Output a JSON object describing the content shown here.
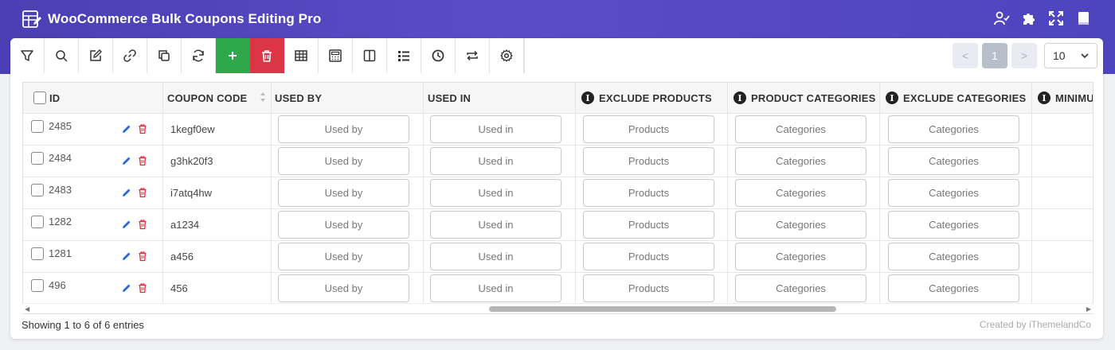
{
  "app": {
    "title": "WooCommerce Bulk Coupons Editing Pro"
  },
  "header_icons": [
    "user-check-icon",
    "puzzle-icon",
    "expand-icon",
    "book-icon"
  ],
  "toolbar": {
    "buttons": [
      {
        "name": "filter-button",
        "icon": "filter-icon"
      },
      {
        "name": "search-button",
        "icon": "search-icon"
      },
      {
        "name": "bulk-edit-button",
        "icon": "edit-icon"
      },
      {
        "name": "bind-edit-button",
        "icon": "link-icon"
      },
      {
        "name": "duplicate-button",
        "icon": "duplicate-icon"
      },
      {
        "name": "reload-button",
        "icon": "refresh-icon"
      },
      {
        "name": "add-coupon-button",
        "icon": "plus-icon"
      },
      {
        "name": "delete-button",
        "icon": "trash-icon"
      },
      {
        "name": "column-profiles-button",
        "icon": "table-icon"
      },
      {
        "name": "calculator-button",
        "icon": "calculator-icon"
      },
      {
        "name": "column-manager-button",
        "icon": "columns-icon"
      },
      {
        "name": "meta-fields-button",
        "icon": "list-icon"
      },
      {
        "name": "history-button",
        "icon": "clock-icon"
      },
      {
        "name": "import-export-button",
        "icon": "swap-icon"
      },
      {
        "name": "settings-button",
        "icon": "gear-icon"
      }
    ]
  },
  "pagination": {
    "prev": "<",
    "current": "1",
    "next": ">",
    "per_page": "10"
  },
  "table": {
    "columns": {
      "id": "ID",
      "coupon_code": "COUPON CODE",
      "used_by": "USED BY",
      "used_in": "USED IN",
      "exclude_products": "EXCLUDE PRODUCTS",
      "product_categories": "PRODUCT CATEGORIES",
      "exclude_categories": "EXCLUDE CATEGORIES",
      "minimum": "MINIMU"
    },
    "rows": [
      {
        "id": "2485",
        "code": "1kegf0ew",
        "used_by": "Used by",
        "used_in": "Used in",
        "excl_products": "Products",
        "prod_cats": "Categories",
        "excl_cats": "Categories"
      },
      {
        "id": "2484",
        "code": "g3hk20f3",
        "used_by": "Used by",
        "used_in": "Used in",
        "excl_products": "Products",
        "prod_cats": "Categories",
        "excl_cats": "Categories"
      },
      {
        "id": "2483",
        "code": "i7atq4hw",
        "used_by": "Used by",
        "used_in": "Used in",
        "excl_products": "Products",
        "prod_cats": "Categories",
        "excl_cats": "Categories"
      },
      {
        "id": "1282",
        "code": "a1234",
        "used_by": "Used by",
        "used_in": "Used in",
        "excl_products": "Products",
        "prod_cats": "Categories",
        "excl_cats": "Categories"
      },
      {
        "id": "1281",
        "code": "a456",
        "used_by": "Used by",
        "used_in": "Used in",
        "excl_products": "Products",
        "prod_cats": "Categories",
        "excl_cats": "Categories"
      },
      {
        "id": "496",
        "code": "456",
        "used_by": "Used by",
        "used_in": "Used in",
        "excl_products": "Products",
        "prod_cats": "Categories",
        "excl_cats": "Categories"
      }
    ]
  },
  "footer": {
    "entries": "Showing 1 to 6 of 6 entries",
    "credit": "Created by iThemelandCo"
  },
  "colors": {
    "header": "#4a3fb3",
    "add": "#2ea84a",
    "delete": "#dc3545",
    "edit_icon": "#2b6cd4",
    "delete_icon": "#d9303e"
  }
}
